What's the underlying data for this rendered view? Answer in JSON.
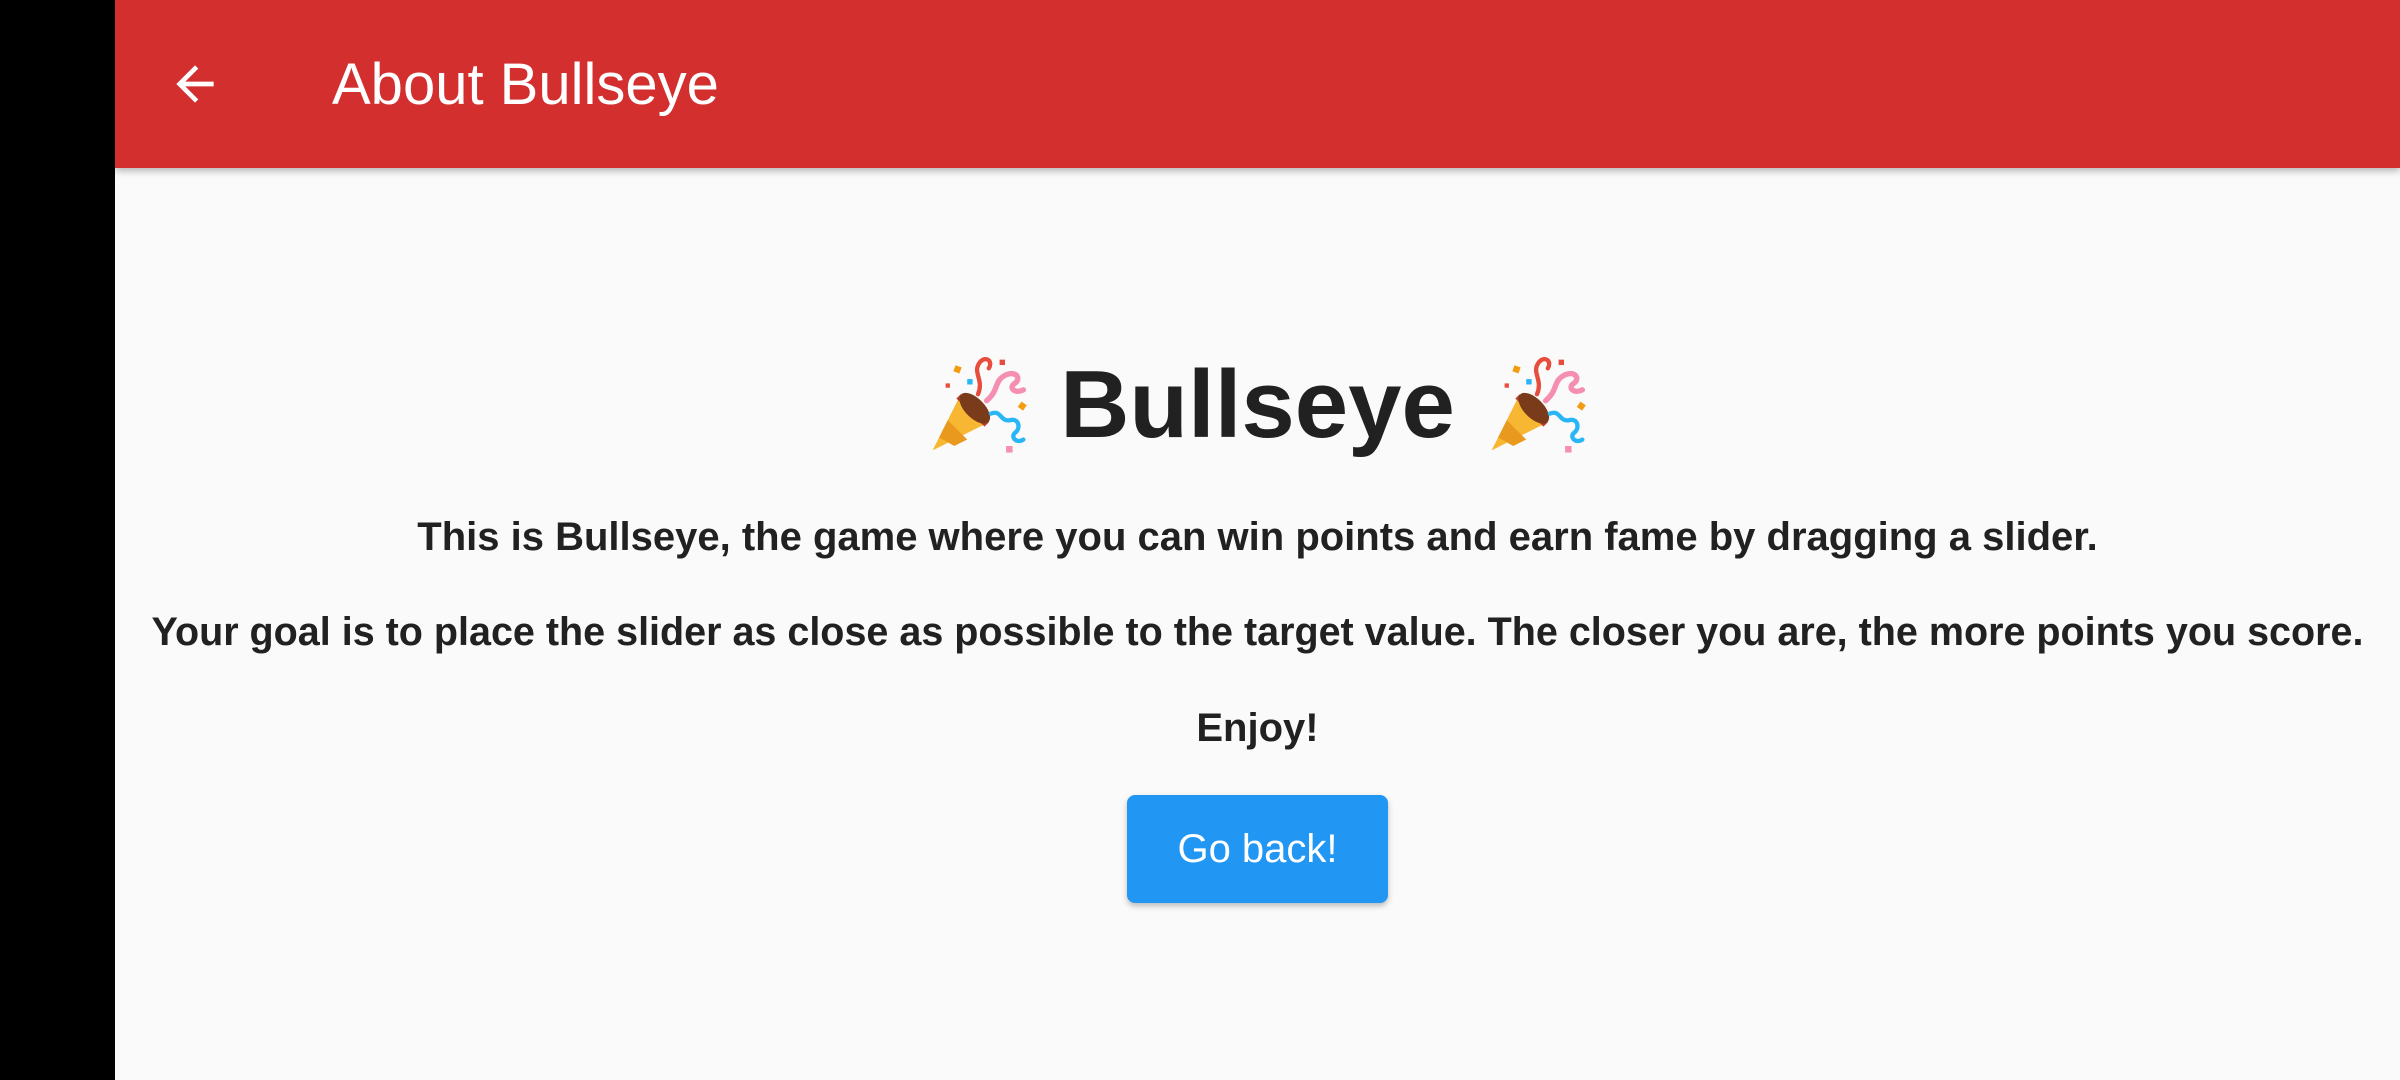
{
  "appbar": {
    "title": "About Bullseye",
    "background_color": "#d32f2f",
    "back_icon": "arrow-left-icon"
  },
  "main": {
    "headline": "Bullseye",
    "headline_icon": "party-popper-icon",
    "paragraphs": [
      "This is Bullseye, the game where you can win points and earn fame by dragging a slider.",
      "Your goal is to place the slider as close as possible to the target value. The closer you are, the more points you score.",
      "Enjoy!"
    ],
    "go_back_button": {
      "label": "Go back!",
      "color": "#2196f3"
    }
  }
}
